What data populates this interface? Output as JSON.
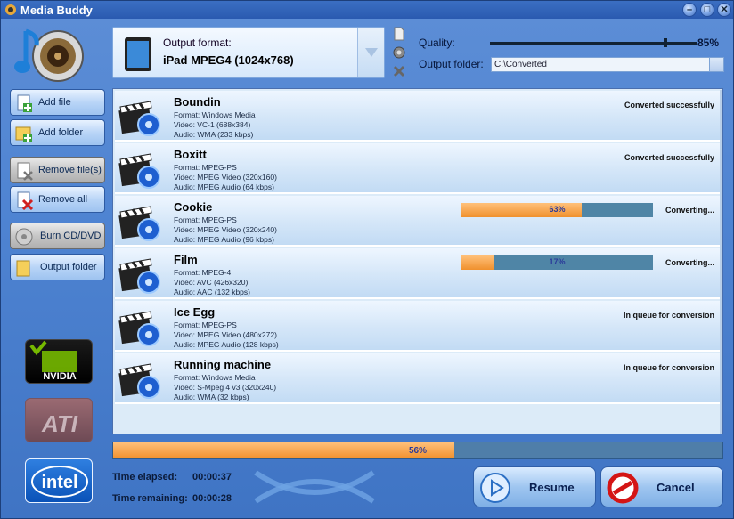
{
  "window": {
    "title": "Media Buddy"
  },
  "sidebar": {
    "items": [
      {
        "label": "Add file"
      },
      {
        "label": "Add folder"
      },
      {
        "label": "Remove file(s)"
      },
      {
        "label": "Remove all"
      },
      {
        "label": "Burn CD/DVD"
      },
      {
        "label": "Output folder"
      }
    ],
    "vendors": [
      "NVIDIA",
      "ATI",
      "intel"
    ]
  },
  "format": {
    "label": "Output format:",
    "value": "iPad MPEG4 (1024x768)"
  },
  "quality": {
    "label": "Quality:",
    "value": "85%",
    "level": 0.85
  },
  "output_folder": {
    "label": "Output folder:",
    "value": "C:\\Converted"
  },
  "files": [
    {
      "name": "Boundin",
      "format": "Format: Windows Media",
      "video": "Video: VC-1 (688x384)",
      "audio": "Audio: WMA (233 kbps)",
      "status": "Converted successfully"
    },
    {
      "name": "Boxitt",
      "format": "Format: MPEG-PS",
      "video": "Video: MPEG Video (320x160)",
      "audio": "Audio: MPEG Audio (64 kbps)",
      "status": "Converted successfully"
    },
    {
      "name": "Cookie",
      "format": "Format: MPEG-PS",
      "video": "Video: MPEG Video (320x240)",
      "audio": "Audio: MPEG Audio (96 kbps)",
      "status": "Converting...",
      "progress": "63%",
      "progress_value": 0.63
    },
    {
      "name": "Film",
      "format": "Format: MPEG-4",
      "video": "Video: AVC (426x320)",
      "audio": "Audio: AAC (132 kbps)",
      "status": "Converting...",
      "progress": "17%",
      "progress_value": 0.17
    },
    {
      "name": "Ice Egg",
      "format": "Format: MPEG-PS",
      "video": "Video: MPEG Video (480x272)",
      "audio": "Audio: MPEG Audio (128 kbps)",
      "status": "In queue for conversion"
    },
    {
      "name": "Running machine",
      "format": "Format: Windows Media",
      "video": "Video: S-Mpeg 4 v3 (320x240)",
      "audio": "Audio: WMA (32 kbps)",
      "status": "In queue for conversion"
    }
  ],
  "total": {
    "progress": "56%",
    "progress_value": 0.56
  },
  "time": {
    "elapsed_label": "Time elapsed:",
    "elapsed": "00:00:37",
    "remaining_label": "Time remaining:",
    "remaining": "00:00:28"
  },
  "buttons": {
    "resume": "Resume",
    "cancel": "Cancel"
  }
}
